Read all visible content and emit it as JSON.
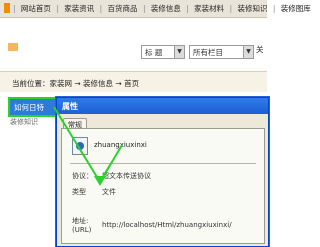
{
  "nav": {
    "items": [
      {
        "label": "网站首页"
      },
      {
        "label": "家装资讯"
      },
      {
        "label": "百货商品"
      },
      {
        "label": "装修信息"
      },
      {
        "label": "家装材料"
      },
      {
        "label": "装修知识"
      },
      {
        "label": "装修图库"
      }
    ]
  },
  "search": {
    "kind_select": "标 题",
    "category_select": "所有栏目",
    "submit_label": "关",
    "dropdown_glyph": "▼"
  },
  "breadcrumb": {
    "text": "当前位置：家装网 → 装修信息 → 首页"
  },
  "annotation": {
    "callout": "如何日特",
    "small": "装修知识"
  },
  "dialog": {
    "title": "属性",
    "tab_label": "常规",
    "file_name": "zhuangxiuxinxi",
    "rows": {
      "protocol_label": "协议：",
      "protocol_value": "超文本传送协议",
      "type_label": "类型",
      "type_value": "文件",
      "address_label": "地址:(URL)",
      "address_value": "http://localhost/Html/zhuangxiuxinxi/"
    }
  },
  "colors": {
    "accent_green": "#2bd22b",
    "callout_blue": "#2c7bd8",
    "title_blue": "#1d5fd6",
    "nav_bg": "#e9e4d9"
  }
}
